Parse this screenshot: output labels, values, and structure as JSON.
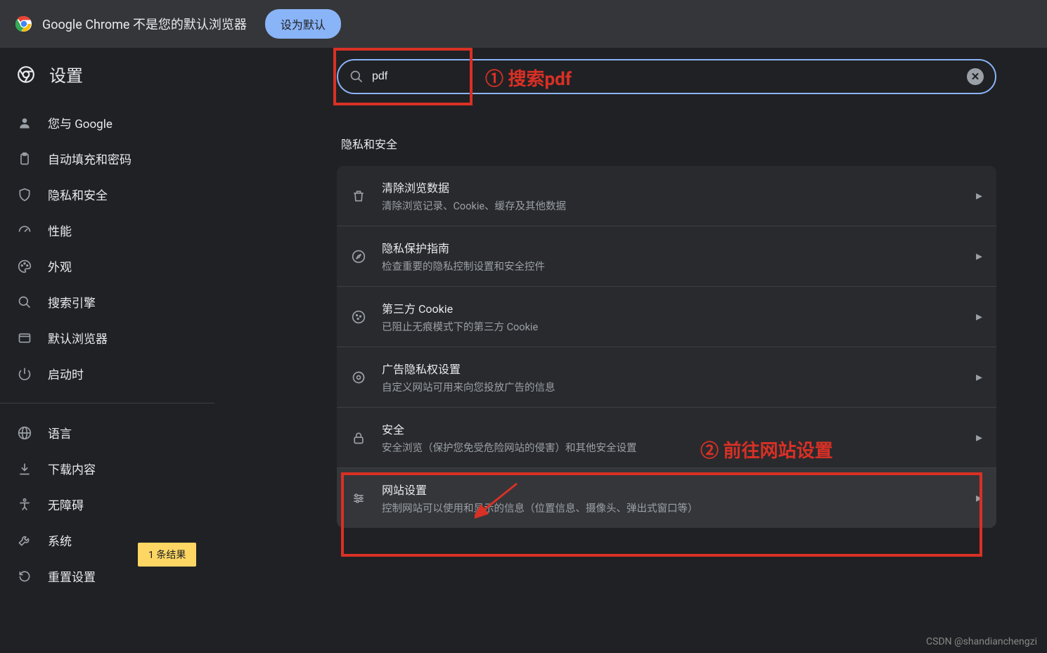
{
  "banner": {
    "text": "Google Chrome 不是您的默认浏览器",
    "button": "设为默认"
  },
  "sidebar": {
    "title": "设置",
    "items": [
      {
        "icon": "person",
        "label": "您与 Google"
      },
      {
        "icon": "autofill",
        "label": "自动填充和密码"
      },
      {
        "icon": "shield",
        "label": "隐私和安全"
      },
      {
        "icon": "speed",
        "label": "性能"
      },
      {
        "icon": "palette",
        "label": "外观"
      },
      {
        "icon": "search",
        "label": "搜索引擎"
      },
      {
        "icon": "browser",
        "label": "默认浏览器"
      },
      {
        "icon": "power",
        "label": "启动时"
      }
    ],
    "items2": [
      {
        "icon": "globe",
        "label": "语言"
      },
      {
        "icon": "download",
        "label": "下载内容"
      },
      {
        "icon": "accessibility",
        "label": "无障碍"
      },
      {
        "icon": "wrench",
        "label": "系统"
      },
      {
        "icon": "reset",
        "label": "重置设置"
      }
    ]
  },
  "search": {
    "value": "pdf"
  },
  "section": {
    "title": "隐私和安全",
    "rows": [
      {
        "icon": "trash",
        "title": "清除浏览数据",
        "sub": "清除浏览记录、Cookie、缓存及其他数据"
      },
      {
        "icon": "compass",
        "title": "隐私保护指南",
        "sub": "检查重要的隐私控制设置和安全控件"
      },
      {
        "icon": "cookie",
        "title": "第三方 Cookie",
        "sub": "已阻止无痕模式下的第三方 Cookie"
      },
      {
        "icon": "ads",
        "title": "广告隐私权设置",
        "sub": "自定义网站可用来向您投放广告的信息"
      },
      {
        "icon": "lock",
        "title": "安全",
        "sub": "安全浏览（保护您免受危险网站的侵害）和其他安全设置"
      },
      {
        "icon": "sliders",
        "title": "网站设置",
        "sub": "控制网站可以使用和显示的信息（位置信息、摄像头、弹出式窗口等）"
      }
    ]
  },
  "result_badge": "1 条结果",
  "annotations": {
    "label1": "① 搜索pdf",
    "label2": "② 前往网站设置"
  },
  "watermark": "CSDN @shandianchengzi"
}
